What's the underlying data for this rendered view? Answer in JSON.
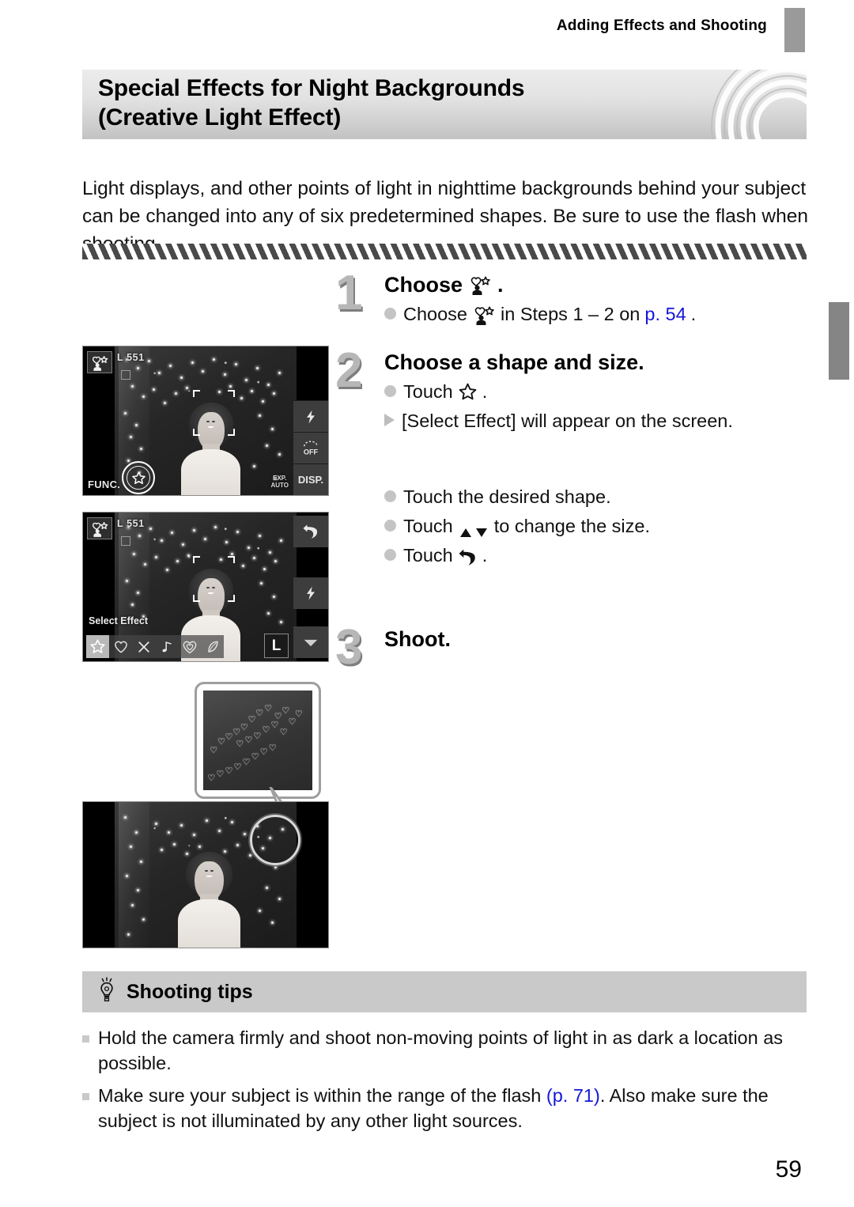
{
  "running_head": {
    "text": "Adding Effects and Shooting"
  },
  "title": {
    "line1": "Special Effects for Night Backgrounds",
    "line2": "(Creative Light Effect)"
  },
  "intro": "Light displays, and other points of light in nighttime backgrounds behind your subject can be changed into any of six predetermined shapes. Be sure to use the flash when shooting.",
  "steps": [
    {
      "num": "1",
      "heading_pre": "Choose",
      "heading_post": ".",
      "heading_icon": "creative-light-effect-mode-icon",
      "subs": [
        {
          "type": "dot",
          "pre": "Choose",
          "icon": "creative-light-effect-mode-icon",
          "mid": "in Steps 1 – 2 on",
          "link": "p. 54",
          "post": "."
        }
      ]
    },
    {
      "num": "2",
      "heading_pre": "Choose a shape and size.",
      "heading_post": "",
      "subs": [
        {
          "type": "dot",
          "pre": "Touch",
          "icon": "star-icon",
          "mid": "",
          "post": "."
        },
        {
          "type": "tri",
          "pre": "[Select Effect] will appear on the screen.",
          "post": ""
        },
        {
          "type": "dot",
          "pre": "Touch the desired shape.",
          "post": ""
        },
        {
          "type": "dot",
          "pre": "Touch",
          "icon": "up-down-arrows-icon",
          "mid": "to change the size.",
          "post": ""
        },
        {
          "type": "dot",
          "pre": "Touch",
          "icon": "back-arrow-icon",
          "mid": "",
          "post": "."
        }
      ]
    },
    {
      "num": "3",
      "heading_pre": "Shoot.",
      "heading_post": "",
      "subs": []
    }
  ],
  "screens": {
    "shot1": {
      "name": "shooting-screen-with-func-star",
      "mode_icon": "creative-light-effect-mode-icon",
      "osd_top": "L 551",
      "osd_quality": "L",
      "shots_remaining": "551",
      "func_label": "FUNC.",
      "func_button_icon": "star-icon",
      "osd_bottom_right_line1": "EXP.",
      "osd_bottom_right_line2": "AUTO",
      "buttons": [
        {
          "icon": "flash-icon",
          "label": ""
        },
        {
          "icon": "self-timer-off-icon",
          "label": "OFF"
        },
        {
          "icon": "disp-icon",
          "label": "DISP."
        }
      ]
    },
    "shot2": {
      "name": "select-effect-screen",
      "mode_icon": "creative-light-effect-mode-icon",
      "osd_top": "L 551",
      "select_label": "Select Effect",
      "effects": [
        {
          "name": "star-shape",
          "selected": true
        },
        {
          "name": "heart-shape",
          "selected": false
        },
        {
          "name": "cross-shape",
          "selected": false
        },
        {
          "name": "music-note-shape",
          "selected": false
        },
        {
          "name": "double-heart-shape",
          "selected": false
        },
        {
          "name": "leaf-shape",
          "selected": false
        }
      ],
      "size_value": "L",
      "buttons": [
        {
          "icon": "back-arrow-icon"
        },
        {
          "icon": "flash-icon"
        },
        {
          "icon": "down-arrow-icon"
        }
      ]
    },
    "shot3": {
      "name": "result-photo-with-magnifier",
      "callout_name": "magnified-heart-bokeh-callout"
    }
  },
  "tips": {
    "title": "Shooting tips",
    "icon": "lightbulb-icon",
    "items": [
      {
        "text_pre": "Hold the camera firmly and shoot non-moving points of light in as dark a location as possible.",
        "link": "",
        "text_post": ""
      },
      {
        "text_pre": "Make sure your subject is within the range of the flash",
        "link": "(p. 71)",
        "text_post": ". Also make sure the subject is not illuminated by any other light sources."
      }
    ]
  },
  "folio": "59",
  "colors": {
    "link_blue": "#1616d8",
    "band_gray": "#c9c9c9",
    "step_num_gray": "#b7b7b7",
    "tab_gray": "#858585"
  }
}
